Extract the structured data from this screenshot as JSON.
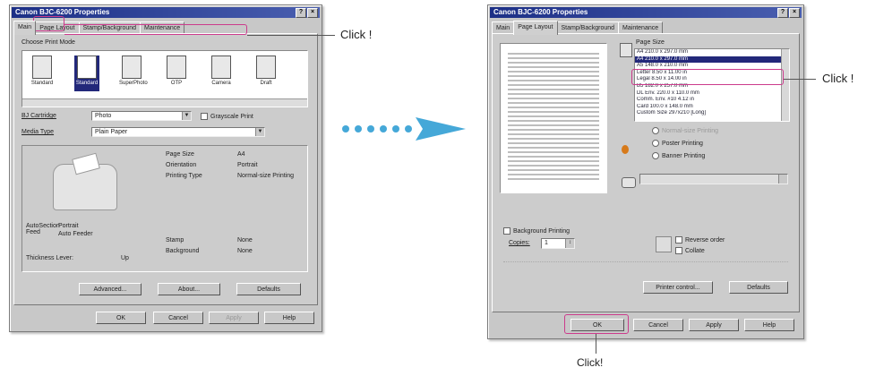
{
  "dialog_title": "Canon BJC-6200 Properties",
  "titlebar_buttons": [
    "?",
    "×"
  ],
  "left": {
    "tabs": [
      "Main",
      "Page Layout",
      "Stamp/Background",
      "Maintenance"
    ],
    "choose_print_mode": "Choose Print Mode",
    "modes": [
      "Standard",
      "Standard",
      "SuperPhoto",
      "OTP",
      "Camera",
      "Draft"
    ],
    "cartridge_label": "BJ Cartridge",
    "cartridge_value": "Photo",
    "grayscale_label": "Grayscale Print",
    "media_label": "Media Type",
    "media_value": "Plain Paper",
    "info_rows": [
      {
        "k": "Page Size",
        "v": "A4"
      },
      {
        "k": "Orientation",
        "v": "Portrait"
      },
      {
        "k": "Printing Type",
        "v": "Normal-size Printing"
      },
      {
        "k": "Stamp",
        "v": "None"
      },
      {
        "k": "Background",
        "v": "None"
      }
    ],
    "feed_label": "AutoSection Feed",
    "feed_values": [
      "Portrait",
      "Auto Feeder"
    ],
    "thickness_label": "Thickness Lever:",
    "thickness_value": "Up",
    "buttons": [
      "Advanced...",
      "About...",
      "Defaults"
    ],
    "footer_buttons": [
      "OK",
      "Cancel",
      "Apply",
      "Help"
    ]
  },
  "right": {
    "tabs": [
      "Main",
      "Page Layout",
      "Stamp/Background",
      "Maintenance"
    ],
    "page_size_label": "Page Size",
    "page_sizes": [
      "A4 210.0 x 297.0 mm",
      "A4 210.0 x 297.0 mm",
      "A5 148.0 x 210.0 mm",
      "Letter 8.50 x 11.00 in",
      "Legal 8.50 x 14.00 in",
      "B5 182.0 x 257.0 mm",
      "DL Env. 220.0 x 110.0 mm",
      "Comm. Env. #10 4.12 in",
      "Card 100.0 x 148.0 mm",
      "Custom Size 297x210 [Long]"
    ],
    "selected_index": 1,
    "options": [
      "Normal-size Printing",
      "Poster Printing",
      "Banner Printing"
    ],
    "background_printing_label": "Background Printing",
    "copies_label": "Copies:",
    "copies_value": "1",
    "reverse_label": "Reverse order",
    "collate_label": "Collate",
    "buttons": [
      "Printer control...",
      "Defaults"
    ],
    "footer_buttons": [
      "OK",
      "Cancel",
      "Apply",
      "Help"
    ]
  },
  "callouts": {
    "tab_click": "Click !",
    "list_click": "Click !",
    "ok_click": "Click!"
  },
  "colors": {
    "highlight": "#cc3b8c",
    "arrow": "#45a8d8",
    "title_bar": "#1c2f86"
  }
}
